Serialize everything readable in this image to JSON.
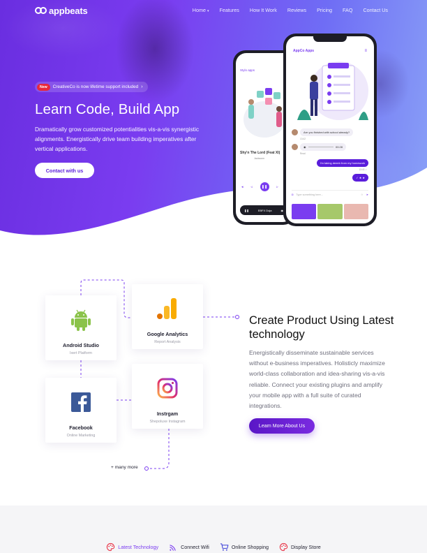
{
  "brand": {
    "name": "appbeats",
    "accent": "#7a3cf0"
  },
  "nav": {
    "items": [
      {
        "label": "Home",
        "caret": "▾"
      },
      {
        "label": "Features"
      },
      {
        "label": "How It Work"
      },
      {
        "label": "Reviews"
      },
      {
        "label": "Pricing"
      },
      {
        "label": "FAQ"
      },
      {
        "label": "Contact Us"
      }
    ]
  },
  "hero": {
    "badge": "New",
    "announcement": "CreativeCo is now lifetime support included",
    "title": "Learn Code, Build App",
    "description": "Dramatically grow customized potentialities vis-a-vis synergistic alignments. Energistically drive team building imperatives after vertical applications.",
    "cta": "Contact with us"
  },
  "phone_back": {
    "app_title": "Stylo apps",
    "song": "Shy'n The Lord (Feat XI)",
    "artist": "Jacksonn",
    "bar_label": "EBFX Doja"
  },
  "phone_front": {
    "app_title": "AppCo Apps",
    "messages": [
      {
        "text": "Are you finished with school already?",
        "time": "13:42",
        "dir": "in"
      },
      {
        "text": "00:28",
        "time": "Read",
        "dir": "in"
      },
      {
        "text": "I'm taking deeeb from my homework",
        "time": "13:43 ✓",
        "dir": "out"
      },
      {
        "text": "✓ ★ ★",
        "dir": "out"
      }
    ],
    "input_placeholder": "Type something here..."
  },
  "integrations": [
    {
      "name": "Android Studio",
      "sub": "Ixert Platform",
      "icon": "android-icon"
    },
    {
      "name": "Google Analytics",
      "sub": "Report Analysis",
      "icon": "google-analytics-icon"
    },
    {
      "name": "Facebook",
      "sub": "Online Marketing",
      "icon": "facebook-icon"
    },
    {
      "name": "Instrgam",
      "sub": "Shepoluxe Instagram",
      "icon": "instagram-icon"
    }
  ],
  "many_more": "+ many more",
  "feature": {
    "title": "Create Product Using Latest technology",
    "description": "Energistically disseminate sustainable services without e-business imperatives. Holisticly maximize world-class collaboration and idea-sharing vis-a-vis reliable. Connect your existing plugins and amplify your mobile app with a full suite of curated integrations.",
    "cta": "Learn More About Us"
  },
  "tabs": [
    {
      "label": "Latest Technology",
      "icon": "palette-icon",
      "active": true
    },
    {
      "label": "Connect Wifi",
      "icon": "wifi-icon",
      "active": false
    },
    {
      "label": "Online Shopping",
      "icon": "cart-icon",
      "active": false
    },
    {
      "label": "Display Store",
      "icon": "palette-icon",
      "active": false
    }
  ]
}
